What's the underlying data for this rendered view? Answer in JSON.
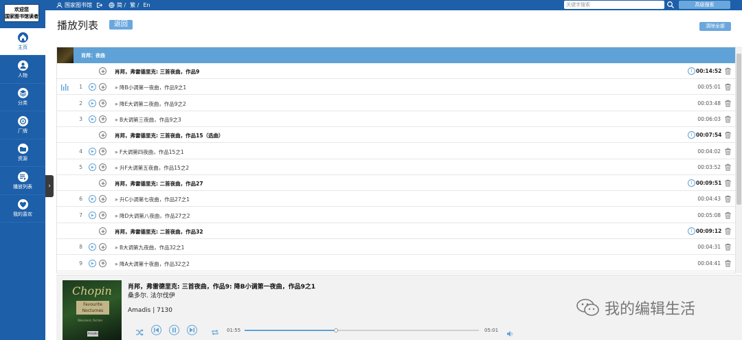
{
  "topbar": {
    "links": [
      {
        "label": "国家图书馆",
        "icon": "user-icon"
      },
      {
        "label": "",
        "icon": "logout-icon"
      },
      {
        "label": "简 /",
        "icon": "globe-icon"
      },
      {
        "label": "繁 /",
        "icon": ""
      },
      {
        "label": "En",
        "icon": ""
      }
    ],
    "search_placeholder": "关键字搜索",
    "advanced_search": "高级搜索"
  },
  "sidebar": {
    "brand_line1": "欢迎您",
    "brand_line2": "国家图书馆读者",
    "items": [
      {
        "label": "主页",
        "icon": "home-icon",
        "active": true
      },
      {
        "label": "人物",
        "icon": "person-icon",
        "active": false
      },
      {
        "label": "分类",
        "icon": "layers-icon",
        "active": false
      },
      {
        "label": "厂牌",
        "icon": "label-icon",
        "active": false
      },
      {
        "label": "资源",
        "icon": "folder-icon",
        "active": false
      },
      {
        "label": "播放列表",
        "icon": "playlist-icon",
        "active": false
      },
      {
        "label": "我的喜欢",
        "icon": "heart-icon",
        "active": false
      }
    ],
    "collapse_glyph": "›"
  },
  "header": {
    "title": "播放列表",
    "back": "返回",
    "clear_all": "清除全部"
  },
  "album": {
    "title": "肖邦：夜曲"
  },
  "rows": [
    {
      "type": "work",
      "num": "",
      "title": "肖邦，弗雷德里克: 三首夜曲，作品9",
      "duration": "00:14:52",
      "playing": false
    },
    {
      "type": "track",
      "num": "1",
      "title": "» 降B小调第一夜曲，作品9之1",
      "duration": "00:05:01",
      "playing": true
    },
    {
      "type": "track",
      "num": "2",
      "title": "» 降E大调第二夜曲，作品9之2",
      "duration": "00:03:48",
      "playing": false
    },
    {
      "type": "track",
      "num": "3",
      "title": "» B大调第三夜曲，作品9之3",
      "duration": "00:06:03",
      "playing": false
    },
    {
      "type": "work",
      "num": "",
      "title": "肖邦，弗雷德里克: 三首夜曲，作品15（选曲）",
      "duration": "00:07:54",
      "playing": false
    },
    {
      "type": "track",
      "num": "4",
      "title": "» F大调第四夜曲，作品15之1",
      "duration": "00:04:02",
      "playing": false
    },
    {
      "type": "track",
      "num": "5",
      "title": "» 升F大调第五夜曲，作品15之2",
      "duration": "00:03:52",
      "playing": false
    },
    {
      "type": "work",
      "num": "",
      "title": "肖邦，弗雷德里克: 二首夜曲，作品27",
      "duration": "00:09:51",
      "playing": false
    },
    {
      "type": "track",
      "num": "6",
      "title": "» 升C小调第七夜曲，作品27之1",
      "duration": "00:04:43",
      "playing": false
    },
    {
      "type": "track",
      "num": "7",
      "title": "» 降D大调第八夜曲，作品27之2",
      "duration": "00:05:08",
      "playing": false
    },
    {
      "type": "work",
      "num": "",
      "title": "肖邦，弗雷德里克: 二首夜曲，作品32",
      "duration": "00:09:12",
      "playing": false
    },
    {
      "type": "track",
      "num": "8",
      "title": "» B大调第九夜曲，作品32之1",
      "duration": "00:04:31",
      "playing": false
    },
    {
      "type": "track",
      "num": "9",
      "title": "» 降A大调第十夜曲，作品32之2",
      "duration": "00:04:41",
      "playing": false
    }
  ],
  "player": {
    "cover_title": "Chopin",
    "cover_subtitle": "Favourite Nocturnes",
    "cover_performer": "Weissbrot, Richter",
    "cover_label": "Amadis",
    "now_playing": "肖邦，弗雷德里克: 三首夜曲，作品9: 降B小调第一夜曲，作品9之1",
    "artist": "桑多尔. 法尔伐伊",
    "label_line": "Amadis | 7130",
    "current_time": "01:55",
    "total_time": "05:01",
    "progress": 0.39
  },
  "watermark": "我的编辑生活",
  "colors": {
    "primary": "#1d5fa8",
    "accent": "#5ea2d7",
    "button": "#6aa7dd"
  }
}
